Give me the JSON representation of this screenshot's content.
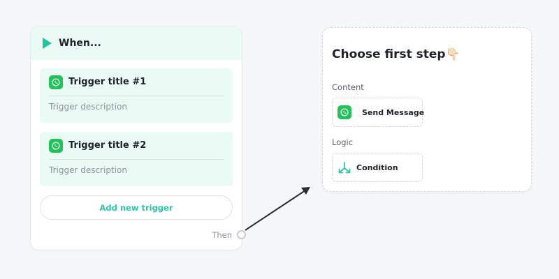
{
  "trigger_block": {
    "header_title": "When...",
    "triggers": [
      {
        "title": "Trigger title #1",
        "description": "Trigger description",
        "icon": "whatsapp-icon"
      },
      {
        "title": "Trigger title #2",
        "description": "Trigger description",
        "icon": "whatsapp-icon"
      }
    ],
    "add_button_label": "Add new trigger",
    "then_label": "Then"
  },
  "step_chooser": {
    "title": "Choose first step👇🏻",
    "sections": [
      {
        "label": "Content",
        "options": [
          {
            "label": "Send Message",
            "icon": "whatsapp-icon"
          }
        ]
      },
      {
        "label": "Logic",
        "options": [
          {
            "label": "Condition",
            "icon": "split-arrows-icon"
          }
        ]
      }
    ]
  },
  "colors": {
    "accent": "#2fc6a4",
    "whatsapp": "#22c15a",
    "panel_tint": "#eafaf4",
    "background": "#f6f7f9"
  }
}
